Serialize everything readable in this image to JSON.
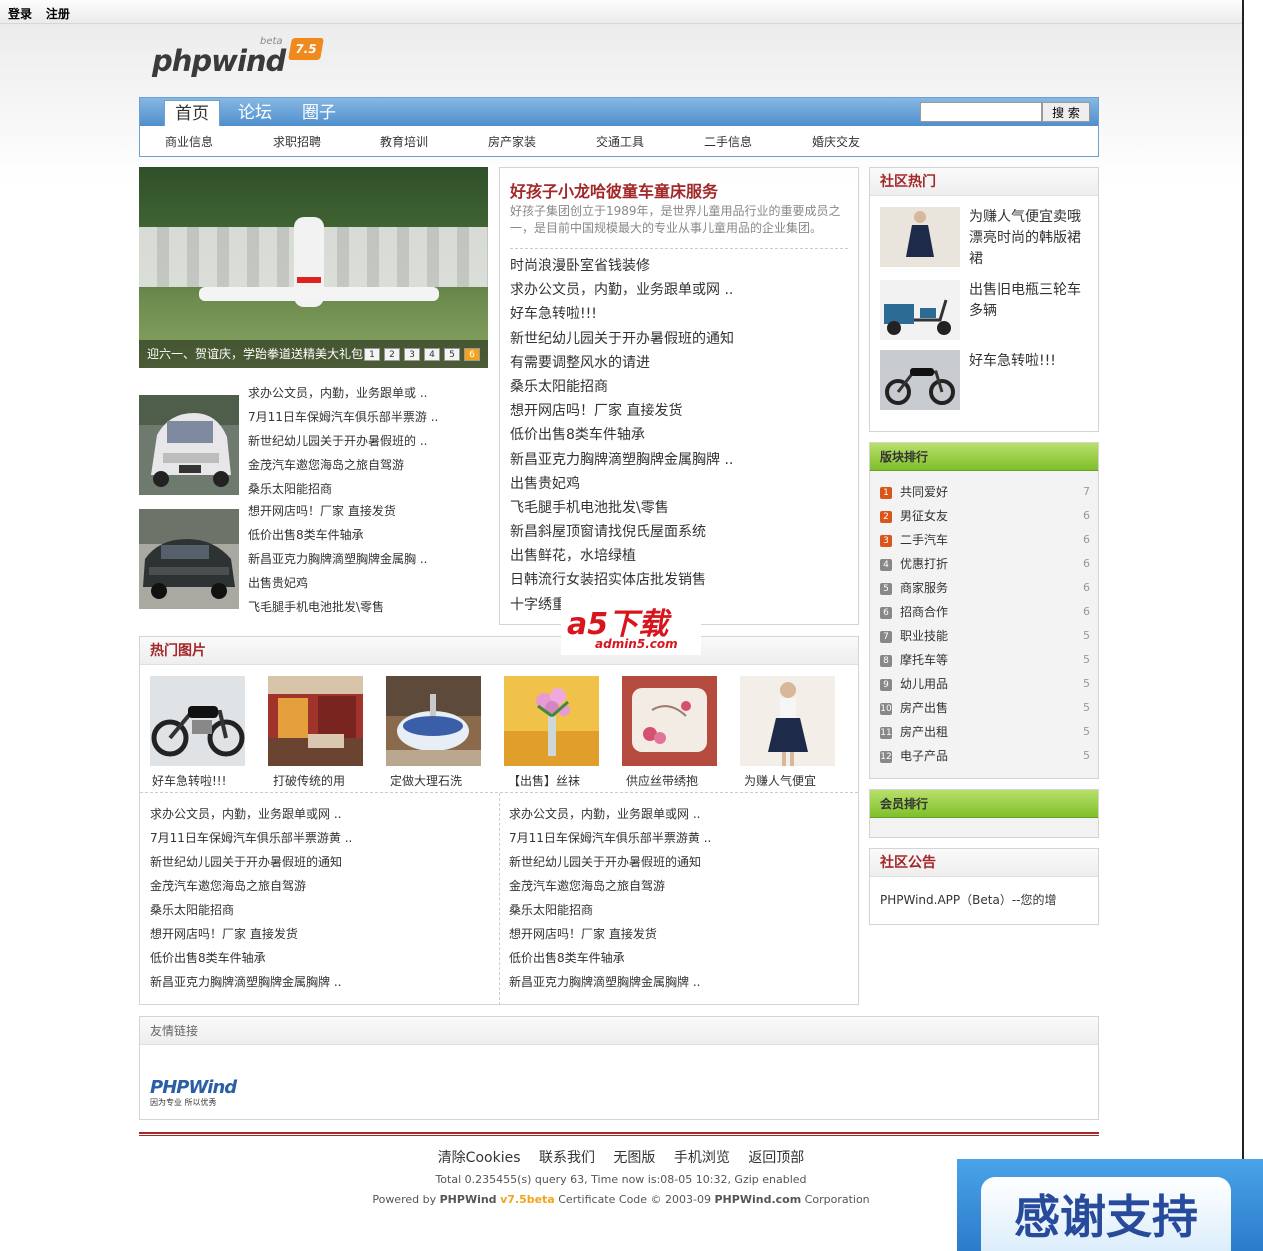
{
  "topbar": {
    "login": "登录",
    "register": "注册"
  },
  "logo": {
    "text": "phpwind",
    "beta": "beta",
    "version": "7.5"
  },
  "nav": {
    "tabs": [
      "首页",
      "论坛",
      "圈子"
    ],
    "search_button": "搜 索",
    "subnav": [
      "商业信息",
      "求职招聘",
      "教育培训",
      "房产家装",
      "交通工具",
      "二手信息",
      "婚庆交友"
    ]
  },
  "slideshow": {
    "caption": "迎六一、贺谊庆，学跆拳道送精美大礼包",
    "pages": [
      "1",
      "2",
      "3",
      "4",
      "5",
      "6"
    ],
    "active_page": 6
  },
  "left_list_1": [
    "求办公文员，内勤，业务跟单或 ..",
    "7月11日车保姆汽车俱乐部半票游 ..",
    "新世纪幼儿园关于开办暑假班的 ..",
    "金茂汽车邀您海岛之旅自驾游",
    "桑乐太阳能招商"
  ],
  "left_list_2": [
    "想开网店吗！厂家 直接发货",
    "低价出售8类车件轴承",
    "新昌亚克力胸牌滴塑胸牌金属胸 ..",
    "出售贵妃鸡",
    "飞毛腿手机电池批发\\零售"
  ],
  "featured": {
    "title": "好孩子小龙哈彼童车童床服务",
    "desc": "好孩子集团创立于1989年，是世界儿童用品行业的重要成员之一，是目前中国规模最大的专业从事儿童用品的企业集团。",
    "items": [
      "时尚浪漫卧室省钱装修",
      "求办公文员，内勤，业务跟单或网 ..",
      "好车急转啦!!!",
      "新世纪幼儿园关于开办暑假班的通知",
      "有需要调整风水的请进",
      "桑乐太阳能招商",
      "想开网店吗！厂家 直接发货",
      "低价出售8类车件轴承",
      "新昌亚克力胸牌滴塑胸牌金属胸牌 ..",
      "出售贵妃鸡",
      "飞毛腿手机电池批发\\零售",
      "新昌斜屋顶窗请找倪氏屋面系统",
      "出售鲜花，水培绿植",
      "日韩流行女装招实体店批发销售",
      "十字绣重 原文 .."
    ]
  },
  "hot_pics": {
    "title": "热门图片",
    "captions": [
      "好车急转啦!!!",
      "打破传统的用",
      "定做大理石洗",
      "【出售】丝袜",
      "供应丝带绣抱",
      "为赚人气便宜"
    ],
    "list_left": [
      "求办公文员，内勤，业务跟单或网 ..",
      "7月11日车保姆汽车俱乐部半票游黄 ..",
      "新世纪幼儿园关于开办暑假班的通知",
      "金茂汽车邀您海岛之旅自驾游",
      "桑乐太阳能招商",
      "想开网店吗！厂家 直接发货",
      "低价出售8类车件轴承",
      "新昌亚克力胸牌滴塑胸牌金属胸牌 .."
    ],
    "list_right": [
      "求办公文员，内勤，业务跟单或网 ..",
      "7月11日车保姆汽车俱乐部半票游黄 ..",
      "新世纪幼儿园关于开办暑假班的通知",
      "金茂汽车邀您海岛之旅自驾游",
      "桑乐太阳能招商",
      "想开网店吗！厂家 直接发货",
      "低价出售8类车件轴承",
      "新昌亚克力胸牌滴塑胸牌金属胸牌 .."
    ]
  },
  "community_hot": {
    "title": "社区热门",
    "items": [
      "为赚人气便宜卖哦 漂亮时尚的韩版裙裙",
      "出售旧电瓶三轮车多辆",
      "好车急转啦!!!"
    ]
  },
  "board_rank": {
    "title": "版块排行",
    "items": [
      {
        "num": "1",
        "name": "共同爱好",
        "count": "7"
      },
      {
        "num": "2",
        "name": "男征女友",
        "count": "6"
      },
      {
        "num": "3",
        "name": "二手汽车",
        "count": "6"
      },
      {
        "num": "4",
        "name": "优惠打折",
        "count": "6"
      },
      {
        "num": "5",
        "name": "商家服务",
        "count": "6"
      },
      {
        "num": "6",
        "name": "招商合作",
        "count": "6"
      },
      {
        "num": "7",
        "name": "职业技能",
        "count": "5"
      },
      {
        "num": "8",
        "name": "摩托车等",
        "count": "5"
      },
      {
        "num": "9",
        "name": "幼儿用品",
        "count": "5"
      },
      {
        "num": "10",
        "name": "房产出售",
        "count": "5"
      },
      {
        "num": "11",
        "name": "房产出租",
        "count": "5"
      },
      {
        "num": "12",
        "name": "电子产品",
        "count": "5"
      }
    ]
  },
  "member_rank": {
    "title": "会员排行"
  },
  "notice": {
    "title": "社区公告",
    "text": "PHPWind.APP（Beta）--您的增"
  },
  "friend_links": {
    "title": "友情链接",
    "logo_text": "PHPWind",
    "logo_slogan": "因为专业 所以优秀"
  },
  "footer": {
    "links": [
      "清除Cookies",
      "联系我们",
      "无图版",
      "手机浏览",
      "返回顶部"
    ],
    "stats": "Total 0.235455(s) query 63, Time now is:08-05 10:32, Gzip enabled",
    "powered_prefix": "Powered by",
    "powered_brand": "PHPWind",
    "powered_version": "v7.5beta",
    "powered_rest": "Certificate Code © 2003-09",
    "powered_site": "PHPWind.com",
    "powered_corp": "Corporation"
  },
  "watermark": {
    "text": "a5下载",
    "url": "admin5.com"
  },
  "thanks": "感谢支持",
  "colors": {
    "accent_red": "#a3282a",
    "nav_blue": "#4f8fcd",
    "rank_green": "#7fbf2a",
    "highlight_orange": "#f2a51a"
  }
}
